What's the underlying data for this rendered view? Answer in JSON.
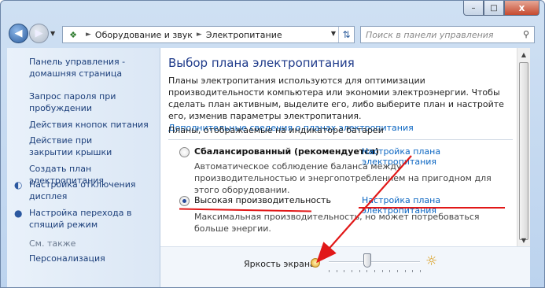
{
  "window": {
    "controls": {
      "minimize": "–",
      "maximize": "□",
      "close": "x"
    }
  },
  "address": {
    "icon": "control-panel-icon",
    "separator": "►",
    "crumbs": [
      "Оборудование и звук",
      "Электропитание"
    ],
    "search_placeholder": "Поиск в панели управления"
  },
  "sidebar": {
    "items": [
      {
        "label": "Панель управления - домашняя страница",
        "icon": null
      },
      {
        "label": "Запрос пароля при пробуждении",
        "icon": null
      },
      {
        "label": "Действия кнопок питания",
        "icon": null
      },
      {
        "label": "Действие при закрытии крышки",
        "icon": null
      },
      {
        "label": "Создать план электропитания",
        "icon": null
      },
      {
        "label": "Настройка отключения дисплея",
        "icon": "display-icon"
      },
      {
        "label": "Настройка перехода в спящий режим",
        "icon": "moon-icon"
      }
    ],
    "see_also": "См. также",
    "personalization": "Персонализация"
  },
  "main": {
    "title": "Выбор плана электропитания",
    "description": "Планы электропитания используются для оптимизации производительности компьютера или экономии электроэнергии. Чтобы сделать план активным, выделите его, либо выберите план и настройте его, изменив параметры электропитания.",
    "more_link": "Дополнительные сведения о планах электропитания",
    "group_title": "Планы, отображаемые на индикаторе батареи",
    "plans": [
      {
        "name": "Сбалансированный (рекомендуется)",
        "link": "Настройка плана электропитания",
        "desc": "Автоматическое соблюдение баланса между производительностью и энергопотреблением на пригодном для этого оборудовании.",
        "selected": false
      },
      {
        "name": "Высокая производительность",
        "link": "Настройка плана электропитания",
        "desc": "Максимальная производительность, но может потребоваться больше энергии.",
        "selected": true
      }
    ]
  },
  "bottom": {
    "brightness_label": "Яркость экрана:",
    "brightness_level": 0.42
  },
  "annotation_color": "#e11818"
}
